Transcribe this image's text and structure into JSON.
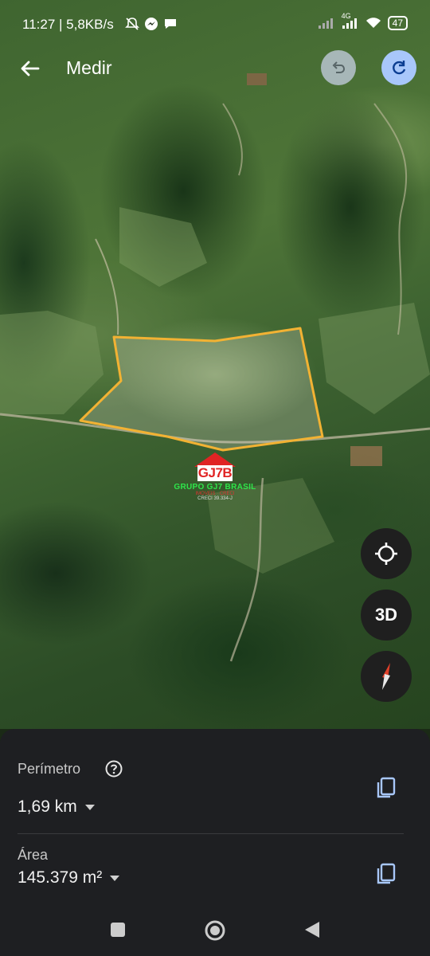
{
  "status_bar": {
    "time": "11:27",
    "speed": "5,8KB/s",
    "network": "4G",
    "battery": "47"
  },
  "header": {
    "title": "Medir"
  },
  "watermark": {
    "logo_text": "GJ7B",
    "name": "GRUPO GJ7 BRASIL",
    "tagline": "IMOVEIS · CRECI",
    "code": "CRECI 39.334-J"
  },
  "map_controls": {
    "threed_label": "3D"
  },
  "measure_panel": {
    "perimeter_label": "Perímetro",
    "perimeter_value": "1,69 km",
    "area_label": "Área",
    "area_value": "145.379 m²"
  },
  "colors": {
    "polygon_stroke": "#f2b233",
    "panel_bg": "#1e1f22",
    "redo_bg": "#a8c7fa",
    "copy_icon": "#a8c7fa"
  }
}
